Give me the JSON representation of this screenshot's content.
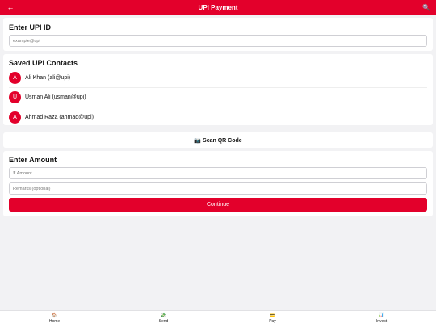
{
  "header": {
    "title": "UPI Payment",
    "back_icon": "←",
    "search_icon": "🔍"
  },
  "upi": {
    "heading": "Enter UPI ID",
    "placeholder": "example@upi"
  },
  "contacts": {
    "heading": "Saved UPI Contacts",
    "items": [
      {
        "initial": "A",
        "label": "Ali Khan (ali@upi)"
      },
      {
        "initial": "U",
        "label": "Usman Ali (usman@upi)"
      },
      {
        "initial": "A",
        "label": "Ahmad Raza (ahmad@upi)"
      }
    ]
  },
  "scan": {
    "label": "📷 Scan QR Code"
  },
  "amount": {
    "heading": "Enter Amount",
    "amount_placeholder": "₹ Amount",
    "remarks_placeholder": "Remarks (optional)",
    "continue_label": "Continue"
  },
  "nav": {
    "items": [
      {
        "icon": "🏠",
        "label": "Home"
      },
      {
        "icon": "💸",
        "label": "Send"
      },
      {
        "icon": "💳",
        "label": "Pay"
      },
      {
        "icon": "📊",
        "label": "Invest"
      }
    ]
  },
  "colors": {
    "brand": "#e3002b",
    "background": "#f2f2f4"
  }
}
